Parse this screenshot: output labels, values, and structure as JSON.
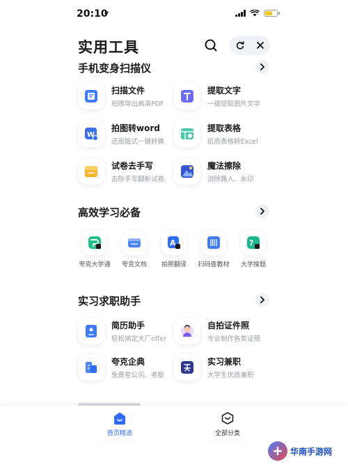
{
  "status": {
    "time": "20:10"
  },
  "header": {
    "title": "实用工具"
  },
  "sections": [
    {
      "title": "手机变身扫描仪",
      "items": [
        {
          "name": "扫描文件",
          "desc": "拍照导出高清PDF"
        },
        {
          "name": "提取文字",
          "desc": "一键提取图片文字"
        },
        {
          "name": "拍图转word",
          "desc": "还原版式一键转换"
        },
        {
          "name": "提取表格",
          "desc": "纸质表格转Excel"
        },
        {
          "name": "试卷去手写",
          "desc": "去除手写翻新试卷"
        },
        {
          "name": "魔法擦除",
          "desc": "消除路人、水印"
        }
      ]
    },
    {
      "title": "高效学习必备",
      "apps": [
        {
          "label": "夸克大学通"
        },
        {
          "label": "夸克文档"
        },
        {
          "label": "拍照翻译"
        },
        {
          "label": "扫码查教材"
        },
        {
          "label": "大学搜题"
        }
      ]
    },
    {
      "title": "实习求职助手",
      "items": [
        {
          "name": "简历助手",
          "desc": "轻松搞定大厂offer"
        },
        {
          "name": "自拍证件照",
          "desc": "专业制作各类证照"
        },
        {
          "name": "夸克企典",
          "desc": "免费查公司、老板"
        },
        {
          "name": "实习兼职",
          "desc": "大学生优质兼职"
        }
      ]
    }
  ],
  "tabbar": {
    "tabs": [
      {
        "label": "首页精选"
      },
      {
        "label": "全部分类"
      }
    ]
  },
  "watermark": {
    "title": "华南手游网"
  },
  "colors": {
    "accent": "#2f6bff",
    "battery": "#f3c623"
  }
}
